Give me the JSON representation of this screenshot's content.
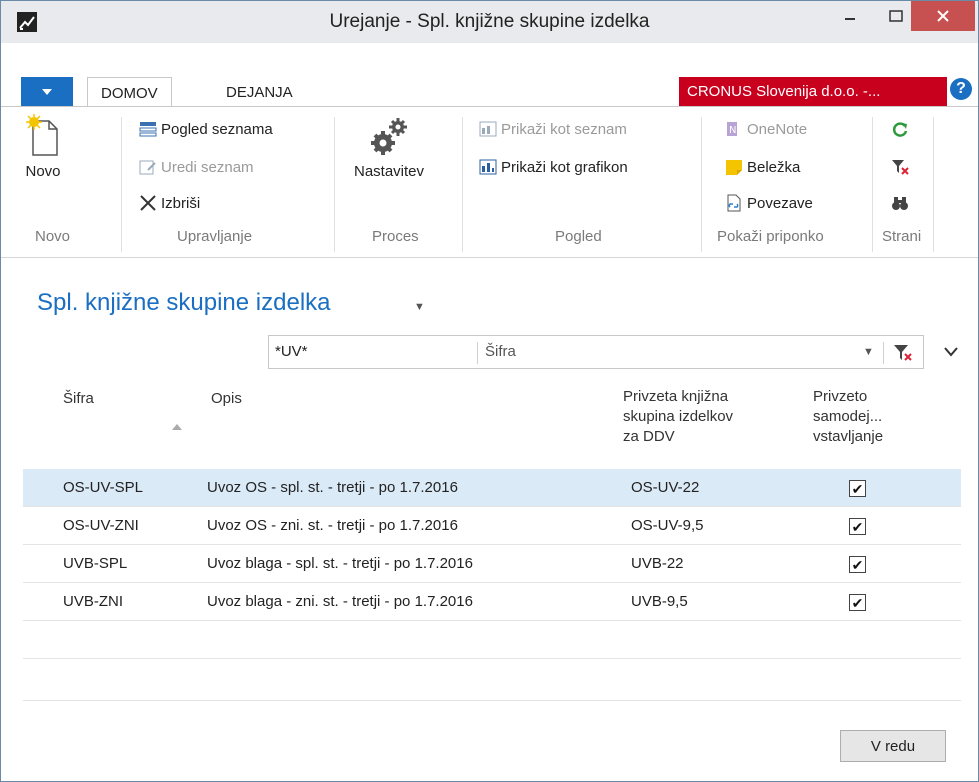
{
  "window": {
    "title": "Urejanje - Spl. knjižne skupine izdelka"
  },
  "tabs": [
    {
      "label": "DOMOV"
    },
    {
      "label": "DEJANJA"
    }
  ],
  "company": "CRONUS Slovenija d.o.o. -...",
  "help_label": "?",
  "ribbon": {
    "novo": {
      "button": "Novo",
      "group": "Novo"
    },
    "upravljanje": {
      "group": "Upravljanje",
      "pogled_seznama": "Pogled seznama",
      "uredi_seznam": "Uredi seznam",
      "izbrisi": "Izbriši"
    },
    "proces": {
      "group": "Proces",
      "nastavitev": "Nastavitev"
    },
    "pogled": {
      "group": "Pogled",
      "prikazi_kot_seznam": "Prikaži kot seznam",
      "prikazi_kot_grafikon": "Prikaži kot grafikon"
    },
    "priponko": {
      "group": "Pokaži priponko",
      "onenote": "OneNote",
      "belezka": "Beležka",
      "povezave": "Povezave"
    },
    "strani": {
      "group": "Strani"
    }
  },
  "page_title": "Spl. knjižne skupine izdelka",
  "filter": {
    "value": "*UV*",
    "field": "Šifra"
  },
  "table": {
    "headers": {
      "sifra": "Šifra",
      "opis": "Opis",
      "ddv_line1": "Privzeta knjižna",
      "ddv_line2": "skupina izdelkov",
      "ddv_line3": "za DDV",
      "auto_line1": "Privzeto",
      "auto_line2": "samodej...",
      "auto_line3": "vstavljanje"
    },
    "rows": [
      {
        "sifra": "OS-UV-SPL",
        "opis": "Uvoz OS - spl. st. - tretji - po 1.7.2016",
        "ddv": "OS-UV-22",
        "auto": "✔"
      },
      {
        "sifra": "OS-UV-ZNI",
        "opis": "Uvoz OS - zni. st. - tretji - po 1.7.2016",
        "ddv": "OS-UV-9,5",
        "auto": "✔"
      },
      {
        "sifra": "UVB-SPL",
        "opis": "Uvoz blaga - spl. st. - tretji - po 1.7.2016",
        "ddv": "UVB-22",
        "auto": "✔"
      },
      {
        "sifra": "UVB-ZNI",
        "opis": "Uvoz blaga - zni. st. - tretji - po 1.7.2016",
        "ddv": "UVB-9,5",
        "auto": "✔"
      }
    ]
  },
  "ok_button": "V redu",
  "colors": {
    "accent": "#1a6fc2",
    "company_bg": "#c8001e",
    "close_bg": "#c75050",
    "selected_row": "#dbeaf7"
  }
}
